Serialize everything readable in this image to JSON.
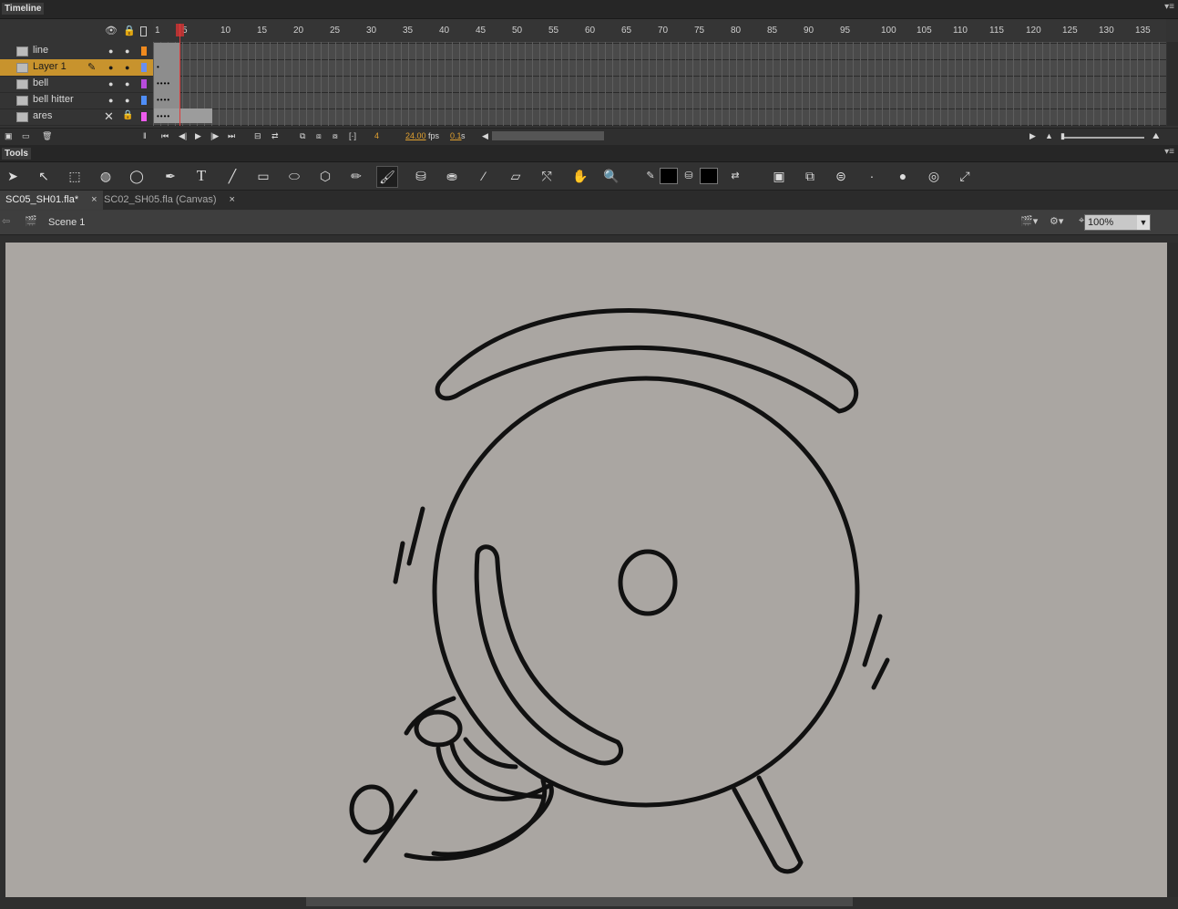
{
  "timeline": {
    "title": "Timeline",
    "ruler_ticks": [
      "1",
      "5",
      "10",
      "15",
      "20",
      "25",
      "30",
      "35",
      "40",
      "45",
      "50",
      "55",
      "60",
      "65",
      "70",
      "75",
      "80",
      "85",
      "90",
      "95",
      "100",
      "105",
      "110",
      "115",
      "120",
      "125",
      "130",
      "135"
    ],
    "layers": [
      {
        "name": "line",
        "color": "#f08a1e",
        "selected": false
      },
      {
        "name": "Layer 1",
        "color": "#6a8ff0",
        "selected": true
      },
      {
        "name": "bell",
        "color": "#b84bdc",
        "selected": false
      },
      {
        "name": "bell hitter",
        "color": "#4f8ef7",
        "selected": false
      },
      {
        "name": "ares",
        "color": "#ee5cee",
        "selected": false
      }
    ],
    "current_frame": "4",
    "fps": "24.00",
    "fps_unit": "fps",
    "time": "0.1",
    "time_unit": "s"
  },
  "tools": {
    "title": "Tools",
    "items": [
      "selection-tool",
      "subselection-tool",
      "free-transform-tool",
      "3d-rotation-tool",
      "lasso-tool",
      "pen-tool",
      "text-tool",
      "line-tool",
      "rectangle-tool",
      "oval-tool",
      "polystar-tool",
      "pencil-tool",
      "brush-tool",
      "paint-bucket-tool",
      "ink-bottle-tool",
      "eyedropper-tool",
      "eraser-tool",
      "width-tool",
      "hand-tool",
      "zoom-tool",
      "stroke-color",
      "fill-color",
      "swap-colors",
      "object-drawing",
      "lock-fill",
      "smoothing",
      "brush-size",
      "brush-shape",
      "pressure",
      "tilt"
    ],
    "text_tool_glyph": "T"
  },
  "documents": {
    "tabs": [
      {
        "label": "SC05_SH01.fla*",
        "active": true
      },
      {
        "label": "SC02_SH05.fla (Canvas)",
        "active": false
      }
    ],
    "close_glyph": "×"
  },
  "editbar": {
    "scene": "Scene 1",
    "zoom": "100%"
  },
  "colors": {
    "stage": "#aaa6a2",
    "selected_layer": "#c8932d",
    "playhead": "#e03a3a"
  }
}
